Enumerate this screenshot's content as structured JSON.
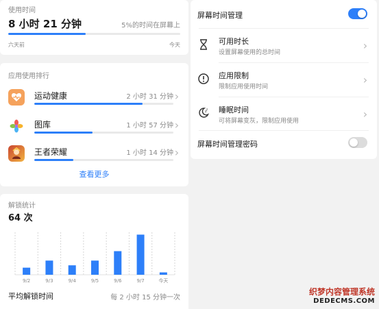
{
  "usage": {
    "title": "使用时间",
    "total": "8 小时 21 分钟",
    "screen_percent": "5%的时间在屏幕上",
    "from": "六天前",
    "to": "今天",
    "progress_percent": 45
  },
  "ranking": {
    "title": "应用使用排行",
    "apps": [
      {
        "name": "运动健康",
        "time": "2 小时 31 分钟",
        "icon": "health-app-icon",
        "progress_percent": 78
      },
      {
        "name": "图库",
        "time": "1 小时 57 分钟",
        "icon": "gallery-app-icon",
        "progress_percent": 42
      },
      {
        "name": "王者荣耀",
        "time": "1 小时 14 分钟",
        "icon": "honor-of-kings-app-icon",
        "progress_percent": 28
      }
    ],
    "more": "查看更多"
  },
  "unlock": {
    "title": "解锁统计",
    "count": "64 次",
    "avg_label": "平均解锁时间",
    "avg_value": "每 2 小时 15 分钟一次"
  },
  "chart_data": {
    "type": "bar",
    "categories": [
      "9/2",
      "9/3",
      "9/4",
      "9/5",
      "9/6",
      "9/7",
      "今天"
    ],
    "values": [
      3,
      6,
      4,
      6,
      10,
      17,
      1
    ],
    "ylim": [
      0,
      18
    ],
    "grid": "vertical dashed",
    "color": "#2d7ff9"
  },
  "settings": {
    "manage_label": "屏幕时间管理",
    "manage_on": true,
    "items": [
      {
        "title": "可用时长",
        "subtitle": "设置屏幕使用的总时间",
        "icon": "hourglass-icon"
      },
      {
        "title": "应用限制",
        "subtitle": "限制应用使用时间",
        "icon": "alert-circle-icon"
      },
      {
        "title": "睡眠时间",
        "subtitle": "可将屏幕变灰，限制应用使用",
        "icon": "moon-sleep-icon"
      }
    ],
    "password_label": "屏幕时间管理密码",
    "password_on": false
  },
  "watermark": {
    "line1": "织梦内容管理系统",
    "line2": "DEDECMS.COM"
  },
  "colors": {
    "accent": "#2d7ff9",
    "toggle_off": "#dcdcdc"
  }
}
